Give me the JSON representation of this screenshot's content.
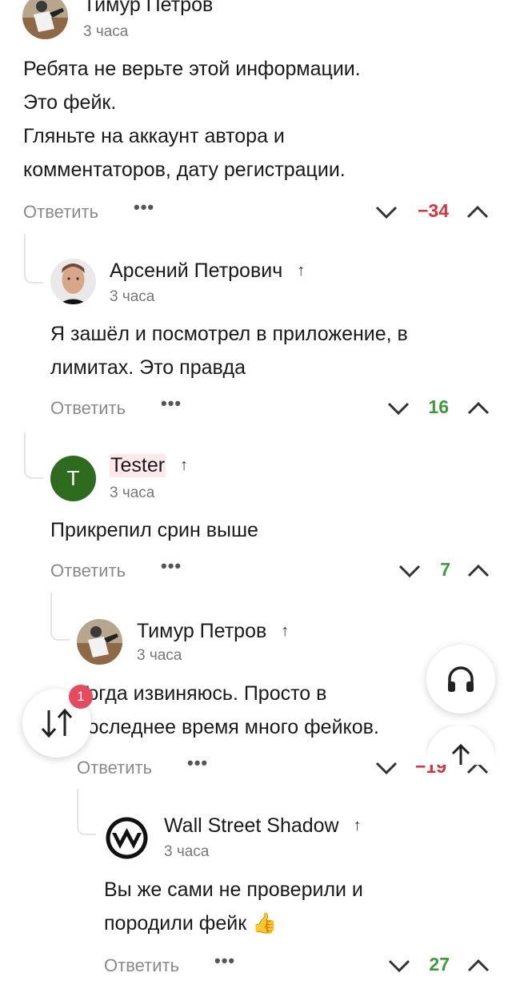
{
  "comments": [
    {
      "author": "Тимур Петров",
      "time": "3 часа",
      "lines": [
        "Ребята не верьте этой информации.",
        "Это фейк.",
        "Гляньте на аккаунт автора и",
        "комментаторов, дату регистрации."
      ],
      "reply_label": "Ответить",
      "more_label": "•••",
      "score": "−34",
      "score_color": "#d8343f"
    },
    {
      "author": "Арсений Петрович",
      "time": "3 часа",
      "lines": [
        "Я зашёл и посмотрел в приложение, в",
        "лимитах. Это правда"
      ],
      "reply_label": "Ответить",
      "more_label": "•••",
      "score": "16",
      "score_color": "#3e9a3b"
    },
    {
      "author": "Tester",
      "avatar_letter": "T",
      "avatar_color": "#2e6b1f",
      "time": "3 часа",
      "lines": [
        "Прикрепил срин выше"
      ],
      "reply_label": "Ответить",
      "more_label": "•••",
      "score": "7",
      "score_color": "#3e9a3b"
    },
    {
      "author": "Тимур Петров",
      "time": "3 часа",
      "lines": [
        "Тогда извиняюсь. Просто в",
        "последнее время много фейков."
      ],
      "reply_label": "Ответить",
      "more_label": "•••",
      "score": "−19",
      "score_color": "#d8343f"
    },
    {
      "author": "Wall Street Shadow",
      "time": "3 часа",
      "lines": [
        "Вы же сами не проверили и",
        "породили фейк 👍"
      ],
      "reply_label": "Ответить",
      "more_label": "•••",
      "score": "27",
      "score_color": "#3e9a3b"
    }
  ],
  "fab": {
    "sort_badge": "1",
    "sort_icon": "sort-arrows-icon",
    "audio_icon": "headphones-icon",
    "scroll_icon": "arrow-up-icon"
  }
}
